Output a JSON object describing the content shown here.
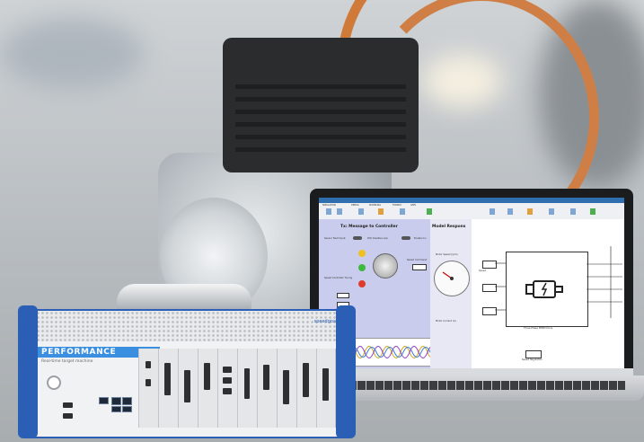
{
  "colors": {
    "accent": "#2a5fb5",
    "performance_bar": "#3a8fe0",
    "cable": "#d07a3a"
  },
  "target_machine": {
    "logo_text": "speedgoat",
    "title": "PERFORMANCE",
    "subtitle": "Real-time target machine"
  },
  "laptop": {
    "left_panel": {
      "title": "Tx: Message to Controller",
      "label_a": "Sensor Fault Input",
      "label_b": "PCU Disable Loop",
      "label_c": "Enable Inv",
      "label_d": "Speed Command",
      "label_e": "Speed Controller Tuning"
    },
    "middle_panel": {
      "title": "Model Respons",
      "label_a": "Motor Speed (rpm)",
      "label_b": "Motor Current (A)"
    },
    "right_panel": {
      "block_label": "Three Phase PMSM Drive",
      "label_a": "Speed",
      "label_b": "Speed Regulation"
    }
  },
  "icons": [
    "motor-icon",
    "gauge-icon",
    "knob-icon",
    "power-button-icon"
  ]
}
